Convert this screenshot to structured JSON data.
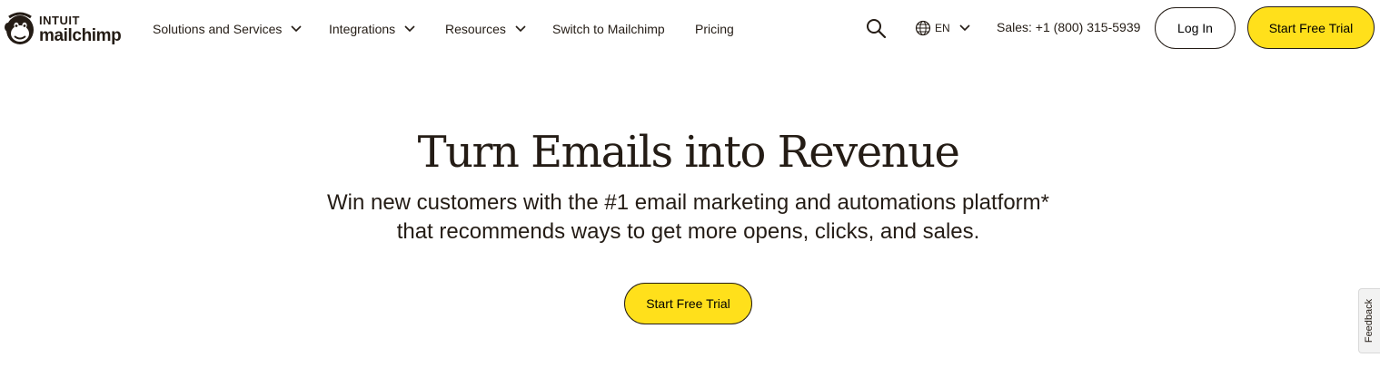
{
  "brand": {
    "top_word": "INTUIT",
    "name": "mailchimp"
  },
  "nav": {
    "items": [
      {
        "label": "Solutions and Services",
        "has_dropdown": true
      },
      {
        "label": "Integrations",
        "has_dropdown": true
      },
      {
        "label": "Resources",
        "has_dropdown": true
      },
      {
        "label": "Switch to Mailchimp",
        "has_dropdown": false
      },
      {
        "label": "Pricing",
        "has_dropdown": false
      }
    ],
    "language": "EN",
    "sales": "Sales: +1 (800) 315-5939",
    "login_label": "Log In",
    "trial_label": "Start Free Trial"
  },
  "hero": {
    "title": "Turn Emails into Revenue",
    "subtitle_line1": "Win new customers with the #1 email marketing and automations platform*",
    "subtitle_line2": "that recommends ways to get more opens, clicks, and sales.",
    "cta_label": "Start Free Trial"
  },
  "feedback": {
    "label": "Feedback"
  },
  "colors": {
    "accent": "#ffe01b",
    "text": "#241c15",
    "background": "#ffffff"
  },
  "icons": {
    "logo": "freddie-monkey-icon",
    "dropdown": "chevron-down-icon",
    "search": "search-icon",
    "language": "globe-icon"
  }
}
